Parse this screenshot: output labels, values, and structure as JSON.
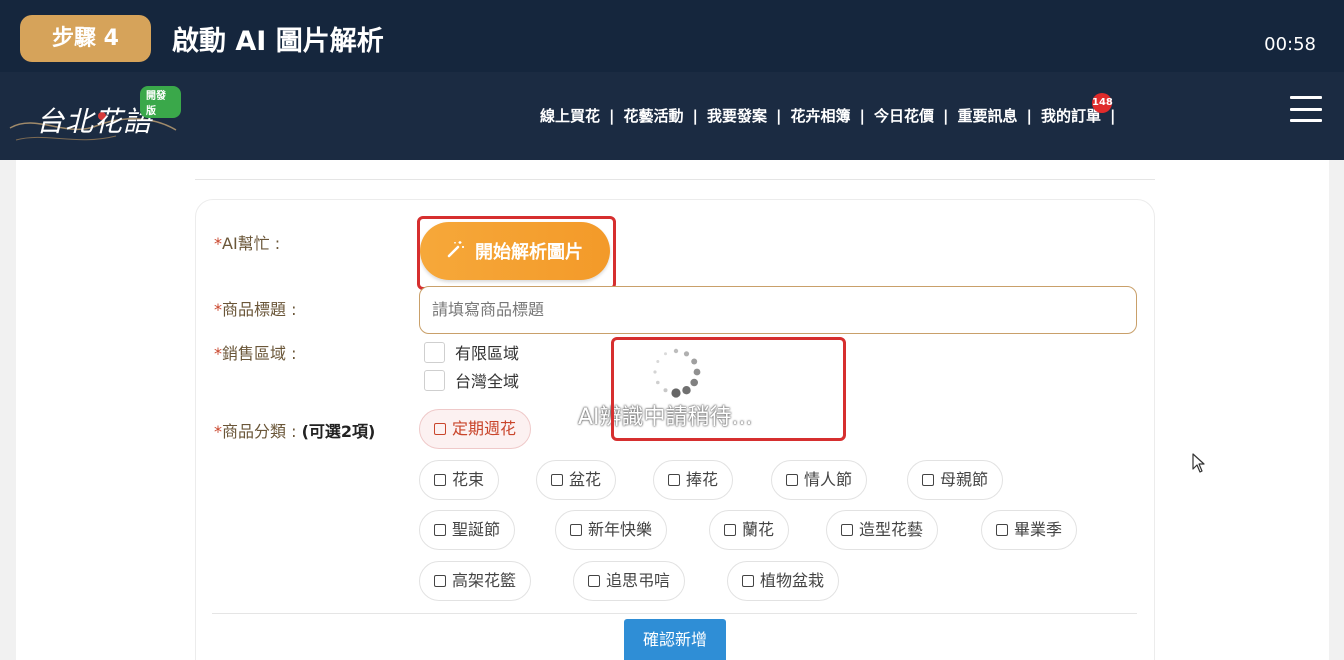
{
  "step": {
    "badge": "步驟 4",
    "title": "啟動 AI 圖片解析",
    "time": "00:58"
  },
  "header": {
    "logo_text": "台北花語",
    "beta_label": "開發版",
    "nav": [
      "線上買花",
      "花藝活動",
      "我要發案",
      "花卉相簿",
      "今日花價",
      "重要訊息",
      "我的訂單"
    ],
    "orders_badge": "148",
    "separator": "|"
  },
  "form": {
    "ai_help_label": "AI幫忙 :",
    "ai_button_label": "開始解析圖片",
    "title_label": "商品標題 :",
    "title_placeholder": "請填寫商品標題",
    "region_label": "銷售區域 :",
    "regions": [
      "有限區域",
      "台灣全域"
    ],
    "category_label": "商品分類 :",
    "category_hint": "(可選2項)",
    "categories": [
      "定期週花",
      "花束",
      "盆花",
      "捧花",
      "情人節",
      "母親節",
      "聖誕節",
      "新年快樂",
      "蘭花",
      "造型花藝",
      "畢業季",
      "高架花籃",
      "追思弔唁",
      "植物盆栽"
    ],
    "selected_category": "定期週花",
    "confirm_label": "確認新增",
    "required_mark": "*"
  },
  "loading": {
    "text": "AI辨識中請稍待..."
  },
  "colors": {
    "step_bar": "#15263d",
    "header": "#1b2b42",
    "badge": "#d6a35a",
    "ai_button": "#f39a29",
    "highlight": "#d62f2f",
    "confirm": "#2f8ed6",
    "accent_label": "#c9452b"
  },
  "icons": {
    "ai_button_icon": "magic-wand-icon",
    "menu_icon": "hamburger-menu-icon",
    "loading_icon": "spinner-icon"
  }
}
